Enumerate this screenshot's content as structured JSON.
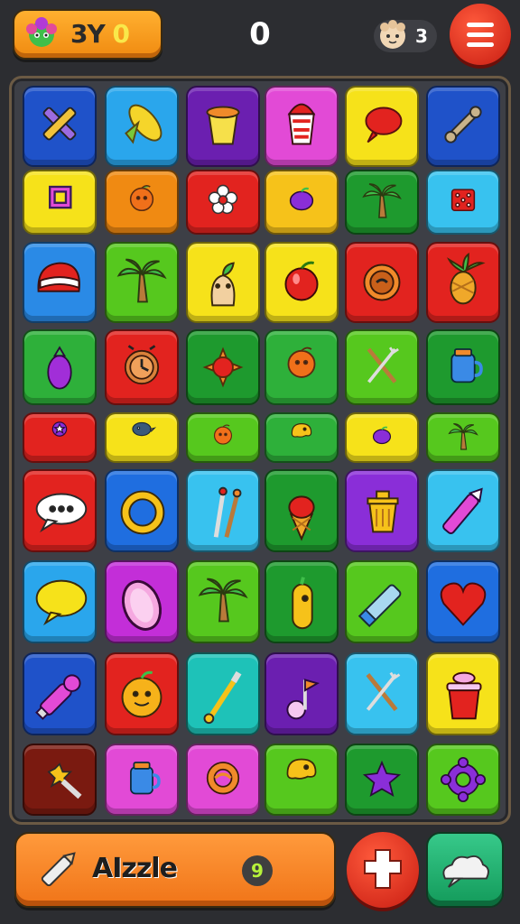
{
  "header": {
    "score_text": "3Y",
    "score_highlight": "0",
    "center_score": "0",
    "lives_count": "3",
    "avatar_icon": "flower-creature-icon",
    "lives_icon": "baby-face-icon",
    "menu_icon": "hamburger-menu-icon"
  },
  "board": {
    "columns": 6,
    "rows": 9,
    "tiles": [
      [
        {
          "color": "#1f52c9",
          "icon": "crossed-tools-icon"
        },
        {
          "color": "#2aa6ec",
          "icon": "corn-icon"
        },
        {
          "color": "#6b1fb0",
          "icon": "cup-icon"
        },
        {
          "color": "#e24ad6",
          "icon": "drink-cup-icon"
        },
        {
          "color": "#f6e21a",
          "icon": "red-balloon-icon"
        },
        {
          "color": "#1f52c9",
          "icon": "bone-icon"
        }
      ],
      [
        {
          "color": "#f6e21a",
          "icon": "frame-icon"
        },
        {
          "color": "#f08a12",
          "icon": "orange-fruit-icon"
        },
        {
          "color": "#e2231f",
          "icon": "flower-icon"
        },
        {
          "color": "#f6c21a",
          "icon": "purple-fruit-icon"
        },
        {
          "color": "#1e9a2e",
          "icon": "palm-tree-icon"
        },
        {
          "color": "#38c2ef",
          "icon": "dice-icon"
        }
      ],
      [
        {
          "color": "#2a8ae6",
          "icon": "white-stripe-icon"
        },
        {
          "color": "#56c81e",
          "icon": "palm-tree-icon"
        },
        {
          "color": "#f6e21a",
          "icon": "sprout-creature-icon"
        },
        {
          "color": "#f6e21a",
          "icon": "apple-icon"
        },
        {
          "color": "#e2231f",
          "icon": "donut-icon"
        },
        {
          "color": "#e2231f",
          "icon": "pineapple-icon"
        }
      ],
      [
        {
          "color": "#2eb03a",
          "icon": "eggplant-icon"
        },
        {
          "color": "#e2231f",
          "icon": "clock-face-icon"
        },
        {
          "color": "#1e9a2e",
          "icon": "sun-icon"
        },
        {
          "color": "#2eb03a",
          "icon": "orange-fruit-icon"
        },
        {
          "color": "#56c81e",
          "icon": "crossed-utensils-icon"
        },
        {
          "color": "#1e9a2e",
          "icon": "jar-icon"
        }
      ],
      [
        {
          "color": "#e2231f",
          "icon": "purple-gem-icon"
        },
        {
          "color": "#f6e21a",
          "icon": "bird-icon"
        },
        {
          "color": "#56c81e",
          "icon": "orange-fruit-icon"
        },
        {
          "color": "#2eb03a",
          "icon": "yellow-creature-icon"
        },
        {
          "color": "#f6e21a",
          "icon": "purple-fruit-icon"
        },
        {
          "color": "#56c81e",
          "icon": "palm-tree-icon"
        }
      ],
      [
        {
          "color": "#e2231f",
          "icon": "speech-bubble-icon"
        },
        {
          "color": "#1f6ee0",
          "icon": "ring-icon"
        },
        {
          "color": "#38c2ef",
          "icon": "brushes-icon"
        },
        {
          "color": "#1e9a2e",
          "icon": "ice-cream-icon"
        },
        {
          "color": "#8a2ed8",
          "icon": "trash-can-icon"
        },
        {
          "color": "#38c2ef",
          "icon": "crayon-icon"
        }
      ],
      [
        {
          "color": "#2aa6ec",
          "icon": "yellow-bubble-icon"
        },
        {
          "color": "#c32ed8",
          "icon": "egg-icon"
        },
        {
          "color": "#56c81e",
          "icon": "palm-tree-icon"
        },
        {
          "color": "#1e9a2e",
          "icon": "banana-creature-icon"
        },
        {
          "color": "#56c81e",
          "icon": "pencil-icon"
        },
        {
          "color": "#1f6ee0",
          "icon": "heart-icon"
        }
      ],
      [
        {
          "color": "#1f52c9",
          "icon": "paint-tube-icon"
        },
        {
          "color": "#e2231f",
          "icon": "smiley-fruit-icon"
        },
        {
          "color": "#1ec2b8",
          "icon": "paintbrush-icon"
        },
        {
          "color": "#6b1fb0",
          "icon": "music-note-icon"
        },
        {
          "color": "#38c2ef",
          "icon": "crossed-utensils-icon"
        },
        {
          "color": "#f6e21a",
          "icon": "bucket-icon"
        }
      ],
      [
        {
          "color": "#7a1a10",
          "icon": "star-wand-icon"
        },
        {
          "color": "#e24ad6",
          "icon": "jar-icon"
        },
        {
          "color": "#e24ad6",
          "icon": "orange-ring-icon"
        },
        {
          "color": "#56c81e",
          "icon": "yellow-creature-icon"
        },
        {
          "color": "#1e9a2e",
          "icon": "purple-star-icon"
        },
        {
          "color": "#56c81e",
          "icon": "purple-gear-icon"
        }
      ]
    ]
  },
  "footer": {
    "label": "AIzzle",
    "badge": "9",
    "left_icon": "pencil-icon",
    "round_button_icon": "cross-icon",
    "square_button_icon": "cloud-icon"
  }
}
